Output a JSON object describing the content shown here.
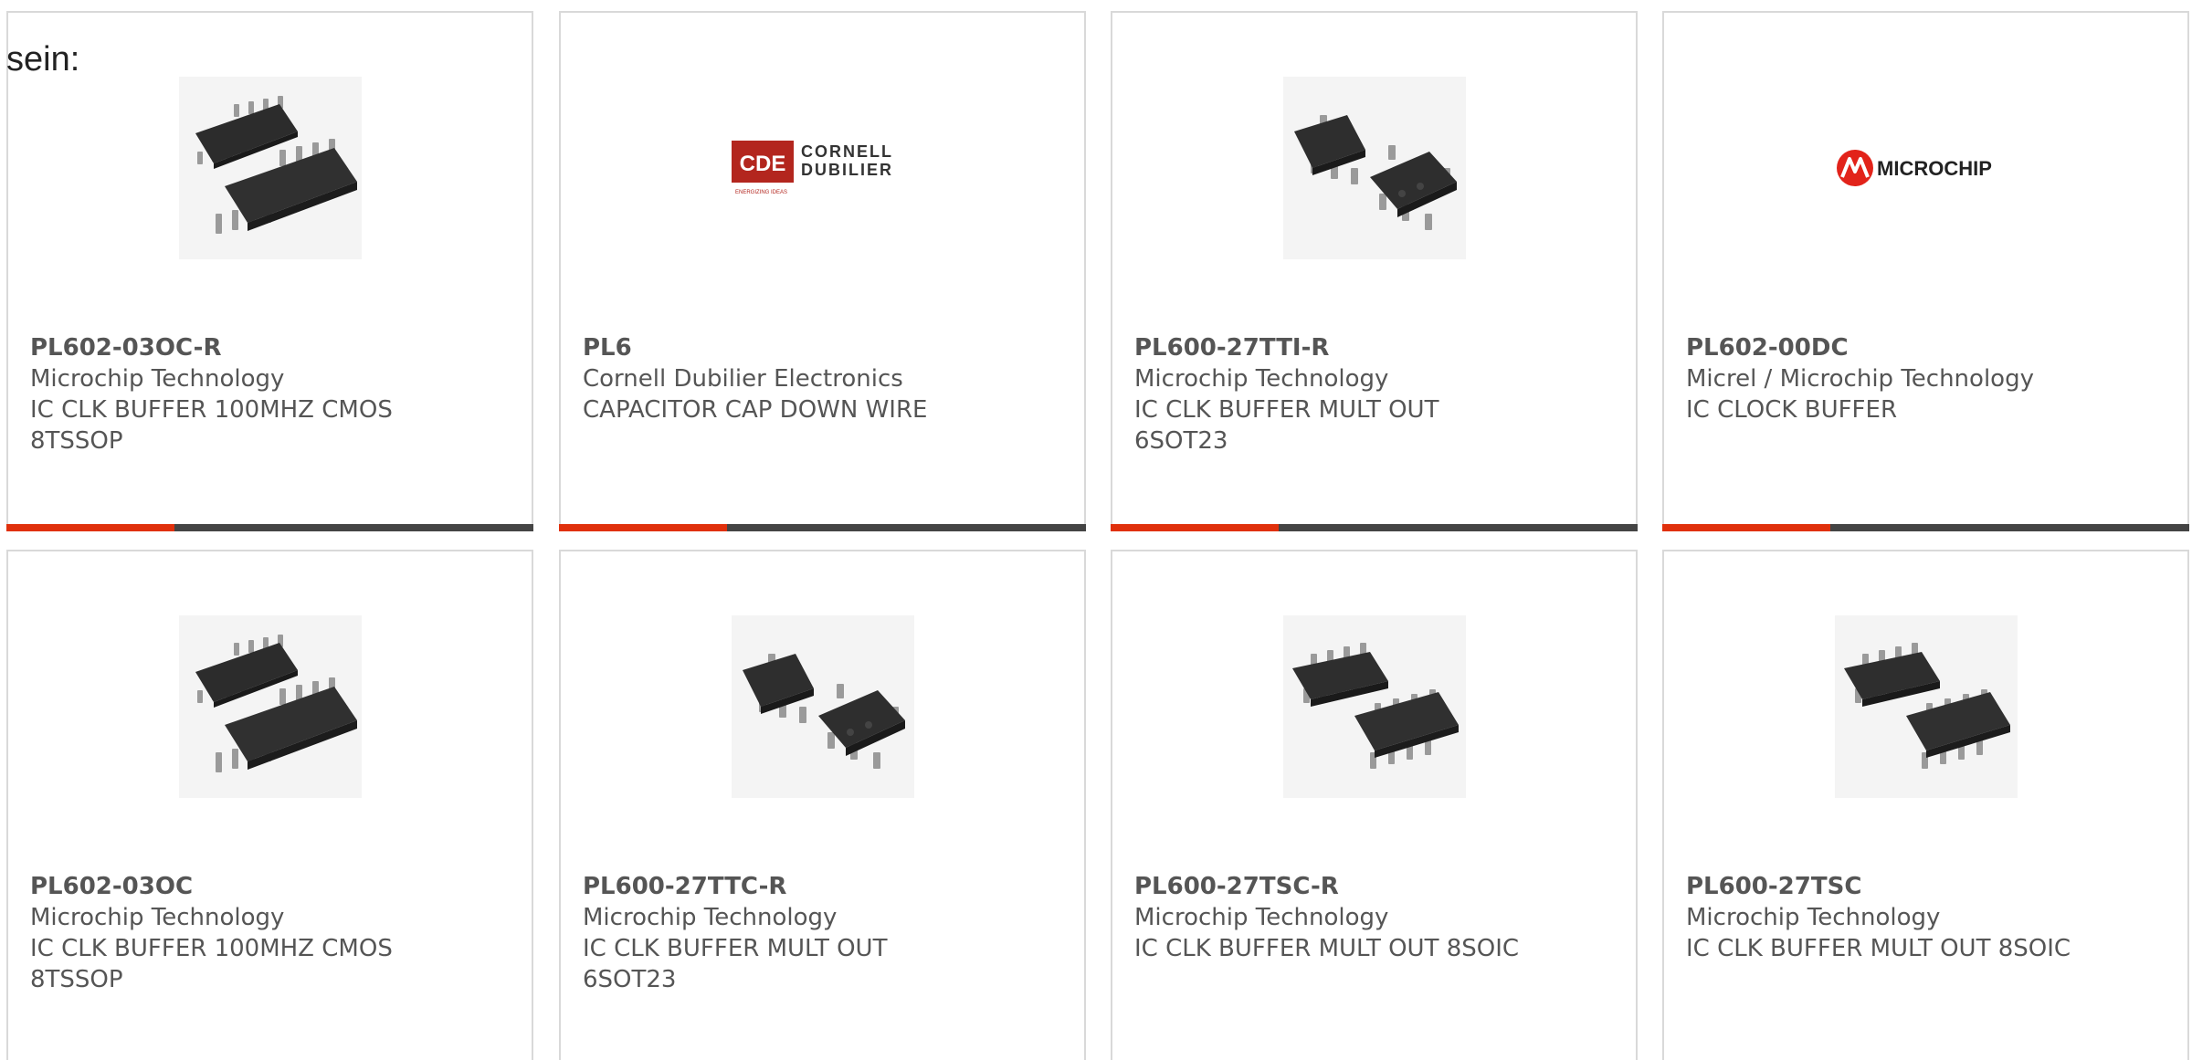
{
  "intro_text": "sein:",
  "colors": {
    "accent": "#e0300c",
    "bar": "#444444",
    "text": "#555555"
  },
  "cards": [
    {
      "part": "PL602-03OC-R",
      "manufacturer": "Microchip Technology",
      "description": "IC CLK BUFFER 100MHZ CMOS\n8TSSOP",
      "image": "tssop-chip"
    },
    {
      "part": "PL6",
      "manufacturer": "Cornell Dubilier Electronics",
      "description": "CAPACITOR CAP DOWN WIRE",
      "image": "cde-logo",
      "logo_text": {
        "mark": "CDE",
        "line1": "CORNELL",
        "line2": "DUBILIER",
        "tagline": "ENERGIZING IDEAS"
      }
    },
    {
      "part": "PL600-27TTI-R",
      "manufacturer": "Microchip Technology",
      "description": "IC CLK BUFFER MULT OUT\n6SOT23",
      "image": "sot23-chip"
    },
    {
      "part": "PL602-00DC",
      "manufacturer": "Micrel / Microchip Technology",
      "description": "IC CLOCK BUFFER",
      "image": "microchip-logo",
      "logo_text": {
        "name": "MICROCHIP"
      }
    },
    {
      "part": "PL602-03OC",
      "manufacturer": "Microchip Technology",
      "description": "IC CLK BUFFER 100MHZ CMOS\n8TSSOP",
      "image": "tssop-chip"
    },
    {
      "part": "PL600-27TTC-R",
      "manufacturer": "Microchip Technology",
      "description": "IC CLK BUFFER MULT OUT\n6SOT23",
      "image": "sot23-chip"
    },
    {
      "part": "PL600-27TSC-R",
      "manufacturer": "Microchip Technology",
      "description": "IC CLK BUFFER MULT OUT 8SOIC",
      "image": "soic-chip"
    },
    {
      "part": "PL600-27TSC",
      "manufacturer": "Microchip Technology",
      "description": "IC CLK BUFFER MULT OUT 8SOIC",
      "image": "soic-chip"
    }
  ]
}
